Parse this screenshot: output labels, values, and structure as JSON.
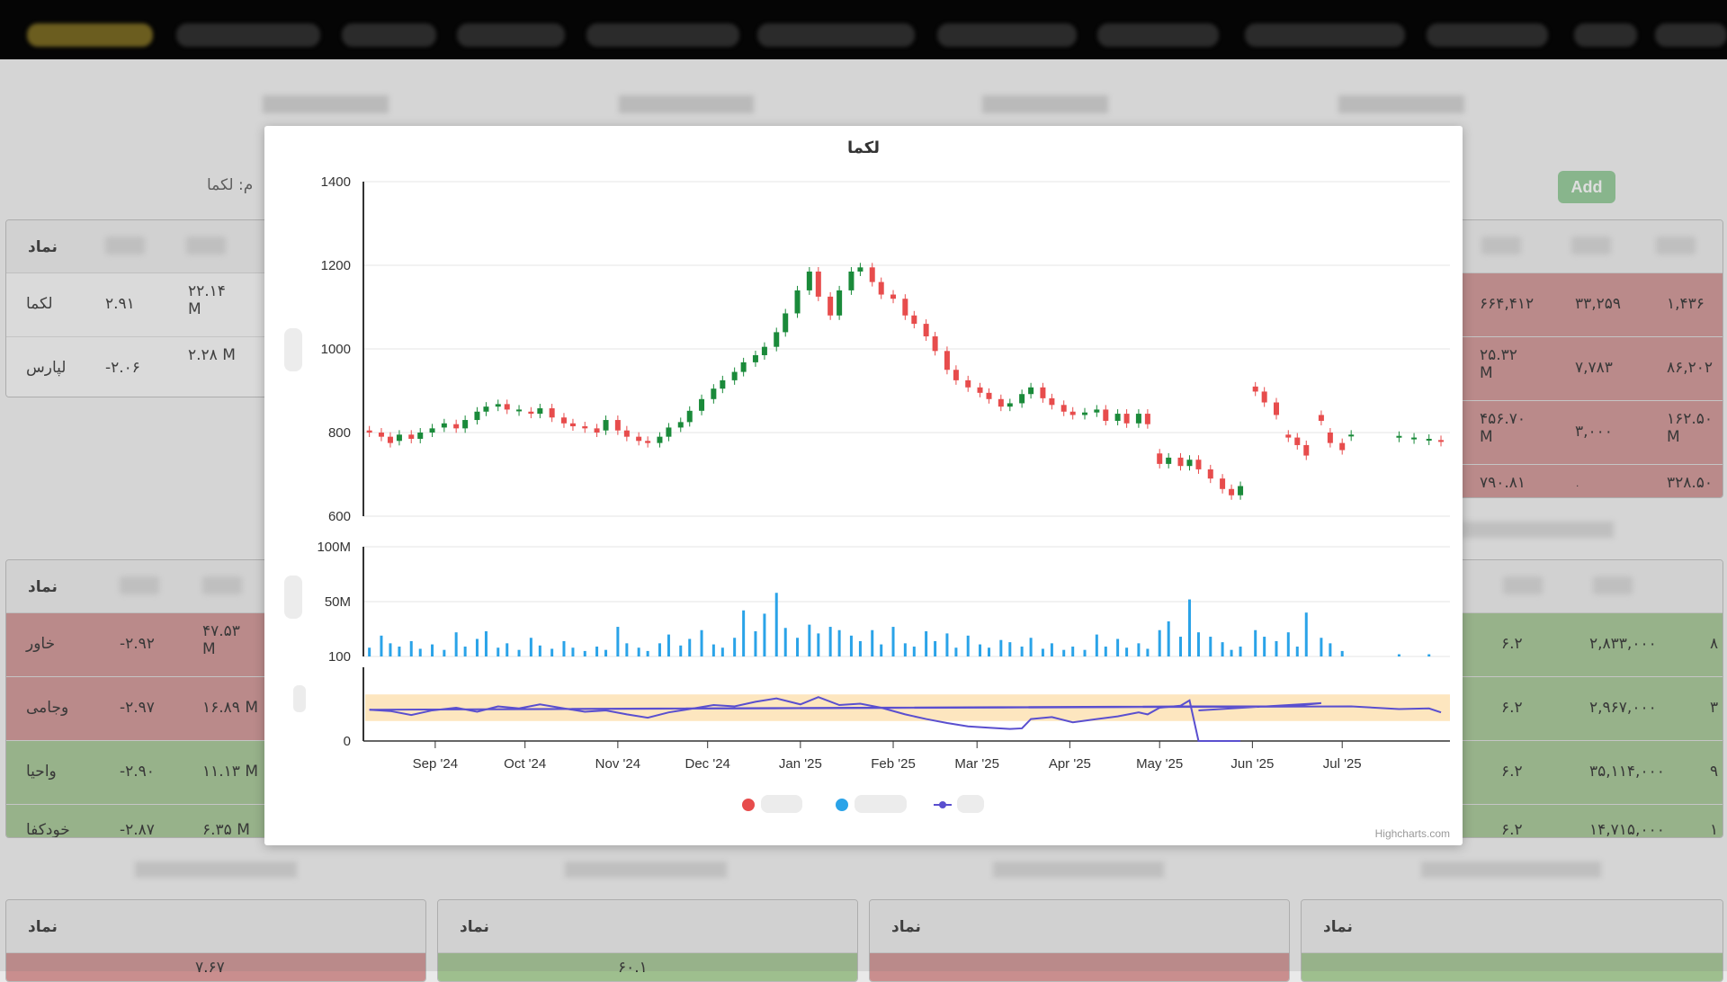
{
  "dashboard": {
    "add_label": "Add",
    "symbol_label": "م: لکما",
    "symbol_col_header": "نماد",
    "left_top_rows": [
      {
        "sym": "لکما",
        "pct": "۲.۹۱",
        "vol": "۲۲.۱۴ M",
        "color": "plain"
      },
      {
        "sym": "لپارس",
        "pct": "-۲.۰۶",
        "vol": "۲.۲۸ M",
        "color": "plain"
      }
    ],
    "right_top_rows": [
      {
        "a": "۶۶۴,۴۱۲",
        "b": "۳۳,۲۵۹",
        "c": "۱,۴۳۶",
        "color": "red"
      },
      {
        "a": "۲۵.۳۲ M",
        "b": "۷,۷۸۳",
        "c": "۸۶,۲۰۲",
        "color": "red"
      },
      {
        "a": "۴۵۶.۷۰ M",
        "b": "۳,۰۰۰",
        "c": "۱۶۲.۵۰ M",
        "color": "red"
      },
      {
        "a": "۷۹۰.۸۱",
        "b": "۰",
        "c": "۳۲۸.۵۰",
        "color": "red"
      }
    ],
    "left_mid_rows": [
      {
        "sym": "خاور",
        "pct": "-۲.۹۲",
        "vol": "۴۷.۵۳ M",
        "color": "red"
      },
      {
        "sym": "وجامی",
        "pct": "-۲.۹۷",
        "vol": "۱۶.۸۹ M",
        "color": "red"
      },
      {
        "sym": "واحیا",
        "pct": "-۲.۹۰",
        "vol": "۱۱.۱۳ M",
        "color": "green"
      },
      {
        "sym": "خودکفا",
        "pct": "-۲.۸۷",
        "vol": "۶.۳۵ M",
        "color": "green"
      }
    ],
    "right_mid_rows": [
      {
        "a": "۶.۲",
        "b": "۲,۸۳۳,۰۰۰",
        "c": "۸",
        "color": "green"
      },
      {
        "a": "۶.۲",
        "b": "۲,۹۶۷,۰۰۰",
        "c": "۳",
        "color": "green"
      },
      {
        "a": "۶.۲",
        "b": "۳۵,۱۱۴,۰۰۰",
        "c": "۹",
        "color": "green"
      },
      {
        "a": "۶.۲",
        "b": "۱۴,۷۱۵,۰۰۰",
        "c": "۱",
        "color": "green"
      }
    ],
    "bottom_left_value": "۷.۶۷",
    "bottom_second_value": "۶۰.۱"
  },
  "colors": {
    "up": "#1a8a3a",
    "down": "#e74c4c",
    "volume": "#2aa3e8",
    "rsi": "#5a4fcf",
    "rsi_band": "#fde6bf"
  },
  "chart_data": {
    "type": "candlestick",
    "title": "لکما",
    "credits": "Highcharts.com",
    "x_ticks": [
      "Sep '24",
      "Oct '24",
      "Nov '24",
      "Dec '24",
      "Jan '25",
      "Feb '25",
      "Mar '25",
      "Apr '25",
      "May '25",
      "Jun '25",
      "Jul '25"
    ],
    "x_tick_dates": [
      "2024-09-01",
      "2024-10-01",
      "2024-11-01",
      "2024-12-01",
      "2025-01-01",
      "2025-02-01",
      "2025-03-01",
      "2025-04-01",
      "2025-05-01",
      "2025-06-01",
      "2025-07-01"
    ],
    "x_range": [
      "2024-08-08",
      "2025-08-06"
    ],
    "price_axis": {
      "ticks": [
        "1400",
        "1200",
        "1000",
        "800",
        "600"
      ],
      "range": [
        600,
        1400
      ]
    },
    "volume_axis": {
      "ticks": [
        "100M",
        "50M",
        "100"
      ],
      "range": [
        0,
        100000000
      ]
    },
    "rsi_axis": {
      "ticks": [
        "0"
      ],
      "range": [
        0,
        100
      ],
      "band": [
        30,
        70
      ]
    },
    "legend": [
      "",
      "",
      ""
    ],
    "price": [
      [
        "2024-08-10",
        805,
        800
      ],
      [
        "2024-08-14",
        800,
        790
      ],
      [
        "2024-08-17",
        790,
        775
      ],
      [
        "2024-08-20",
        780,
        795
      ],
      [
        "2024-08-24",
        795,
        785
      ],
      [
        "2024-08-27",
        785,
        800
      ],
      [
        "2024-08-31",
        800,
        810
      ],
      [
        "2024-09-04",
        812,
        822
      ],
      [
        "2024-09-08",
        820,
        810
      ],
      [
        "2024-09-11",
        810,
        830
      ],
      [
        "2024-09-15",
        830,
        850
      ],
      [
        "2024-09-18",
        850,
        862
      ],
      [
        "2024-09-22",
        862,
        868
      ],
      [
        "2024-09-25",
        868,
        855
      ],
      [
        "2024-09-29",
        855,
        855
      ],
      [
        "2024-10-03",
        850,
        845
      ],
      [
        "2024-10-06",
        845,
        858
      ],
      [
        "2024-10-10",
        858,
        836
      ],
      [
        "2024-10-14",
        836,
        822
      ],
      [
        "2024-10-17",
        822,
        815
      ],
      [
        "2024-10-21",
        815,
        810
      ],
      [
        "2024-10-25",
        810,
        800
      ],
      [
        "2024-10-28",
        805,
        830
      ],
      [
        "2024-11-01",
        830,
        805
      ],
      [
        "2024-11-04",
        805,
        790
      ],
      [
        "2024-11-08",
        790,
        780
      ],
      [
        "2024-11-11",
        780,
        775
      ],
      [
        "2024-11-15",
        775,
        790
      ],
      [
        "2024-11-18",
        790,
        812
      ],
      [
        "2024-11-22",
        812,
        825
      ],
      [
        "2024-11-25",
        825,
        852
      ],
      [
        "2024-11-29",
        852,
        880
      ],
      [
        "2024-12-03",
        880,
        905
      ],
      [
        "2024-12-06",
        905,
        925
      ],
      [
        "2024-12-10",
        925,
        945
      ],
      [
        "2024-12-13",
        945,
        968
      ],
      [
        "2024-12-17",
        968,
        985
      ],
      [
        "2024-12-20",
        985,
        1005
      ],
      [
        "2024-12-24",
        1005,
        1040
      ],
      [
        "2024-12-27",
        1040,
        1085
      ],
      [
        "2024-12-31",
        1085,
        1140
      ],
      [
        "2025-01-04",
        1140,
        1185
      ],
      [
        "2025-01-07",
        1185,
        1125
      ],
      [
        "2025-01-11",
        1125,
        1080
      ],
      [
        "2025-01-14",
        1080,
        1140
      ],
      [
        "2025-01-18",
        1140,
        1185
      ],
      [
        "2025-01-21",
        1185,
        1195
      ],
      [
        "2025-01-25",
        1195,
        1160
      ],
      [
        "2025-01-28",
        1160,
        1130
      ],
      [
        "2025-02-01",
        1130,
        1120
      ],
      [
        "2025-02-05",
        1120,
        1080
      ],
      [
        "2025-02-08",
        1080,
        1060
      ],
      [
        "2025-02-12",
        1060,
        1030
      ],
      [
        "2025-02-15",
        1030,
        995
      ],
      [
        "2025-02-19",
        995,
        950
      ],
      [
        "2025-02-22",
        950,
        925
      ],
      [
        "2025-02-26",
        925,
        908
      ],
      [
        "2025-03-02",
        908,
        895
      ],
      [
        "2025-03-05",
        895,
        880
      ],
      [
        "2025-03-09",
        880,
        862
      ],
      [
        "2025-03-12",
        862,
        870
      ],
      [
        "2025-03-16",
        870,
        892
      ],
      [
        "2025-03-19",
        892,
        908
      ],
      [
        "2025-03-23",
        908,
        882
      ],
      [
        "2025-03-26",
        882,
        866
      ],
      [
        "2025-03-30",
        866,
        850
      ],
      [
        "2025-04-02",
        850,
        842
      ],
      [
        "2025-04-06",
        842,
        848
      ],
      [
        "2025-04-10",
        848,
        855
      ],
      [
        "2025-04-13",
        855,
        828
      ],
      [
        "2025-04-17",
        828,
        845
      ],
      [
        "2025-04-20",
        845,
        822
      ],
      [
        "2025-04-24",
        822,
        845
      ],
      [
        "2025-04-27",
        845,
        820
      ],
      [
        "2025-05-01",
        750,
        725
      ],
      [
        "2025-05-04",
        725,
        740
      ],
      [
        "2025-05-08",
        740,
        720
      ],
      [
        "2025-05-11",
        720,
        735
      ],
      [
        "2025-05-14",
        735,
        712
      ],
      [
        "2025-05-18",
        712,
        690
      ],
      [
        "2025-05-22",
        690,
        665
      ],
      [
        "2025-05-25",
        665,
        650
      ],
      [
        "2025-05-28",
        650,
        672
      ],
      [
        "2025-06-02",
        910,
        898
      ],
      [
        "2025-06-05",
        898,
        872
      ],
      [
        "2025-06-09",
        872,
        842
      ],
      [
        "2025-06-13",
        795,
        788
      ],
      [
        "2025-06-16",
        788,
        770
      ],
      [
        "2025-06-19",
        770,
        745
      ],
      [
        "2025-06-24",
        842,
        828
      ],
      [
        "2025-06-27",
        800,
        775
      ],
      [
        "2025-07-01",
        775,
        758
      ],
      [
        "2025-07-04",
        795,
        795
      ],
      [
        "2025-07-20",
        792,
        792
      ],
      [
        "2025-07-25",
        788,
        788
      ],
      [
        "2025-07-30",
        785,
        785
      ],
      [
        "2025-08-03",
        782,
        780
      ]
    ],
    "volume": [
      [
        "2024-08-10",
        8000000
      ],
      [
        "2024-08-14",
        19000000
      ],
      [
        "2024-08-17",
        12000000
      ],
      [
        "2024-08-20",
        9000000
      ],
      [
        "2024-08-24",
        14000000
      ],
      [
        "2024-08-27",
        7000000
      ],
      [
        "2024-08-31",
        11000000
      ],
      [
        "2024-09-04",
        6000000
      ],
      [
        "2024-09-08",
        22000000
      ],
      [
        "2024-09-11",
        9000000
      ],
      [
        "2024-09-15",
        16000000
      ],
      [
        "2024-09-18",
        23000000
      ],
      [
        "2024-09-22",
        8000000
      ],
      [
        "2024-09-25",
        12000000
      ],
      [
        "2024-09-29",
        6000000
      ],
      [
        "2024-10-03",
        17000000
      ],
      [
        "2024-10-06",
        10000000
      ],
      [
        "2024-10-10",
        7000000
      ],
      [
        "2024-10-14",
        14000000
      ],
      [
        "2024-10-17",
        8000000
      ],
      [
        "2024-10-21",
        5000000
      ],
      [
        "2024-10-25",
        9000000
      ],
      [
        "2024-10-28",
        6000000
      ],
      [
        "2024-11-01",
        27000000
      ],
      [
        "2024-11-04",
        12000000
      ],
      [
        "2024-11-08",
        8000000
      ],
      [
        "2024-11-11",
        5000000
      ],
      [
        "2024-11-15",
        12000000
      ],
      [
        "2024-11-18",
        20000000
      ],
      [
        "2024-11-22",
        10000000
      ],
      [
        "2024-11-25",
        16000000
      ],
      [
        "2024-11-29",
        24000000
      ],
      [
        "2024-12-03",
        11000000
      ],
      [
        "2024-12-06",
        8000000
      ],
      [
        "2024-12-10",
        17000000
      ],
      [
        "2024-12-13",
        42000000
      ],
      [
        "2024-12-17",
        23000000
      ],
      [
        "2024-12-20",
        39000000
      ],
      [
        "2024-12-24",
        58000000
      ],
      [
        "2024-12-27",
        26000000
      ],
      [
        "2024-12-31",
        17000000
      ],
      [
        "2025-01-04",
        29000000
      ],
      [
        "2025-01-07",
        21000000
      ],
      [
        "2025-01-11",
        27000000
      ],
      [
        "2025-01-14",
        24000000
      ],
      [
        "2025-01-18",
        19000000
      ],
      [
        "2025-01-21",
        14000000
      ],
      [
        "2025-01-25",
        24000000
      ],
      [
        "2025-01-28",
        11000000
      ],
      [
        "2025-02-01",
        27000000
      ],
      [
        "2025-02-05",
        12000000
      ],
      [
        "2025-02-08",
        9000000
      ],
      [
        "2025-02-12",
        23000000
      ],
      [
        "2025-02-15",
        14000000
      ],
      [
        "2025-02-19",
        21000000
      ],
      [
        "2025-02-22",
        8000000
      ],
      [
        "2025-02-26",
        19000000
      ],
      [
        "2025-03-02",
        11000000
      ],
      [
        "2025-03-05",
        8000000
      ],
      [
        "2025-03-09",
        15000000
      ],
      [
        "2025-03-12",
        13000000
      ],
      [
        "2025-03-16",
        9000000
      ],
      [
        "2025-03-19",
        17000000
      ],
      [
        "2025-03-23",
        7000000
      ],
      [
        "2025-03-26",
        12000000
      ],
      [
        "2025-03-30",
        6000000
      ],
      [
        "2025-04-02",
        9000000
      ],
      [
        "2025-04-06",
        6000000
      ],
      [
        "2025-04-10",
        20000000
      ],
      [
        "2025-04-13",
        9000000
      ],
      [
        "2025-04-17",
        16000000
      ],
      [
        "2025-04-20",
        8000000
      ],
      [
        "2025-04-24",
        12000000
      ],
      [
        "2025-04-27",
        7000000
      ],
      [
        "2025-05-01",
        24000000
      ],
      [
        "2025-05-04",
        32000000
      ],
      [
        "2025-05-08",
        18000000
      ],
      [
        "2025-05-11",
        52000000
      ],
      [
        "2025-05-14",
        22000000
      ],
      [
        "2025-05-18",
        18000000
      ],
      [
        "2025-05-22",
        13000000
      ],
      [
        "2025-05-25",
        6000000
      ],
      [
        "2025-05-28",
        9000000
      ],
      [
        "2025-06-02",
        24000000
      ],
      [
        "2025-06-05",
        18000000
      ],
      [
        "2025-06-09",
        14000000
      ],
      [
        "2025-06-13",
        22000000
      ],
      [
        "2025-06-16",
        9000000
      ],
      [
        "2025-06-19",
        40000000
      ],
      [
        "2025-06-24",
        17000000
      ],
      [
        "2025-06-27",
        12000000
      ],
      [
        "2025-07-01",
        5000000
      ],
      [
        "2025-07-20",
        2000000
      ],
      [
        "2025-07-30",
        2000000
      ]
    ],
    "rsi": [
      [
        "2024-08-10",
        47
      ],
      [
        "2024-08-17",
        45
      ],
      [
        "2024-08-24",
        39
      ],
      [
        "2024-08-31",
        46
      ],
      [
        "2024-09-08",
        50
      ],
      [
        "2024-09-15",
        44
      ],
      [
        "2024-09-22",
        52
      ],
      [
        "2024-09-29",
        49
      ],
      [
        "2024-10-06",
        55
      ],
      [
        "2024-10-14",
        49
      ],
      [
        "2024-10-21",
        44
      ],
      [
        "2024-10-28",
        46
      ],
      [
        "2024-11-04",
        40
      ],
      [
        "2024-11-11",
        35
      ],
      [
        "2024-11-18",
        43
      ],
      [
        "2024-11-25",
        48
      ],
      [
        "2024-12-03",
        54
      ],
      [
        "2024-12-10",
        52
      ],
      [
        "2024-12-17",
        59
      ],
      [
        "2024-12-24",
        64
      ],
      [
        "2025-01-01",
        55
      ],
      [
        "2025-01-07",
        66
      ],
      [
        "2025-01-14",
        54
      ],
      [
        "2025-01-21",
        56
      ],
      [
        "2025-01-28",
        50
      ],
      [
        "2025-02-05",
        40
      ],
      [
        "2025-02-12",
        33
      ],
      [
        "2025-02-19",
        27
      ],
      [
        "2025-02-26",
        22
      ],
      [
        "2025-03-05",
        20
      ],
      [
        "2025-03-12",
        18
      ],
      [
        "2025-03-16",
        19
      ],
      [
        "2025-03-19",
        33
      ],
      [
        "2025-03-26",
        36
      ],
      [
        "2025-04-02",
        28
      ],
      [
        "2025-04-10",
        33
      ],
      [
        "2025-04-17",
        37
      ],
      [
        "2025-04-24",
        43
      ],
      [
        "2025-04-27",
        40
      ],
      [
        "2025-05-01",
        50
      ],
      [
        "2025-05-08",
        53
      ],
      [
        "2025-05-11",
        61
      ],
      [
        "2025-05-14",
        0
      ],
      [
        "2025-05-28",
        0
      ]
    ],
    "rsi_back_path": [
      [
        "2025-05-14",
        46
      ],
      [
        "2025-06-24",
        57
      ],
      [
        "2025-06-13",
        52
      ],
      [
        "2025-05-11",
        52
      ],
      [
        "2024-08-10",
        47
      ],
      [
        "2025-07-04",
        52
      ],
      [
        "2025-07-20",
        48
      ],
      [
        "2025-07-30",
        49
      ],
      [
        "2025-08-03",
        43
      ]
    ]
  }
}
